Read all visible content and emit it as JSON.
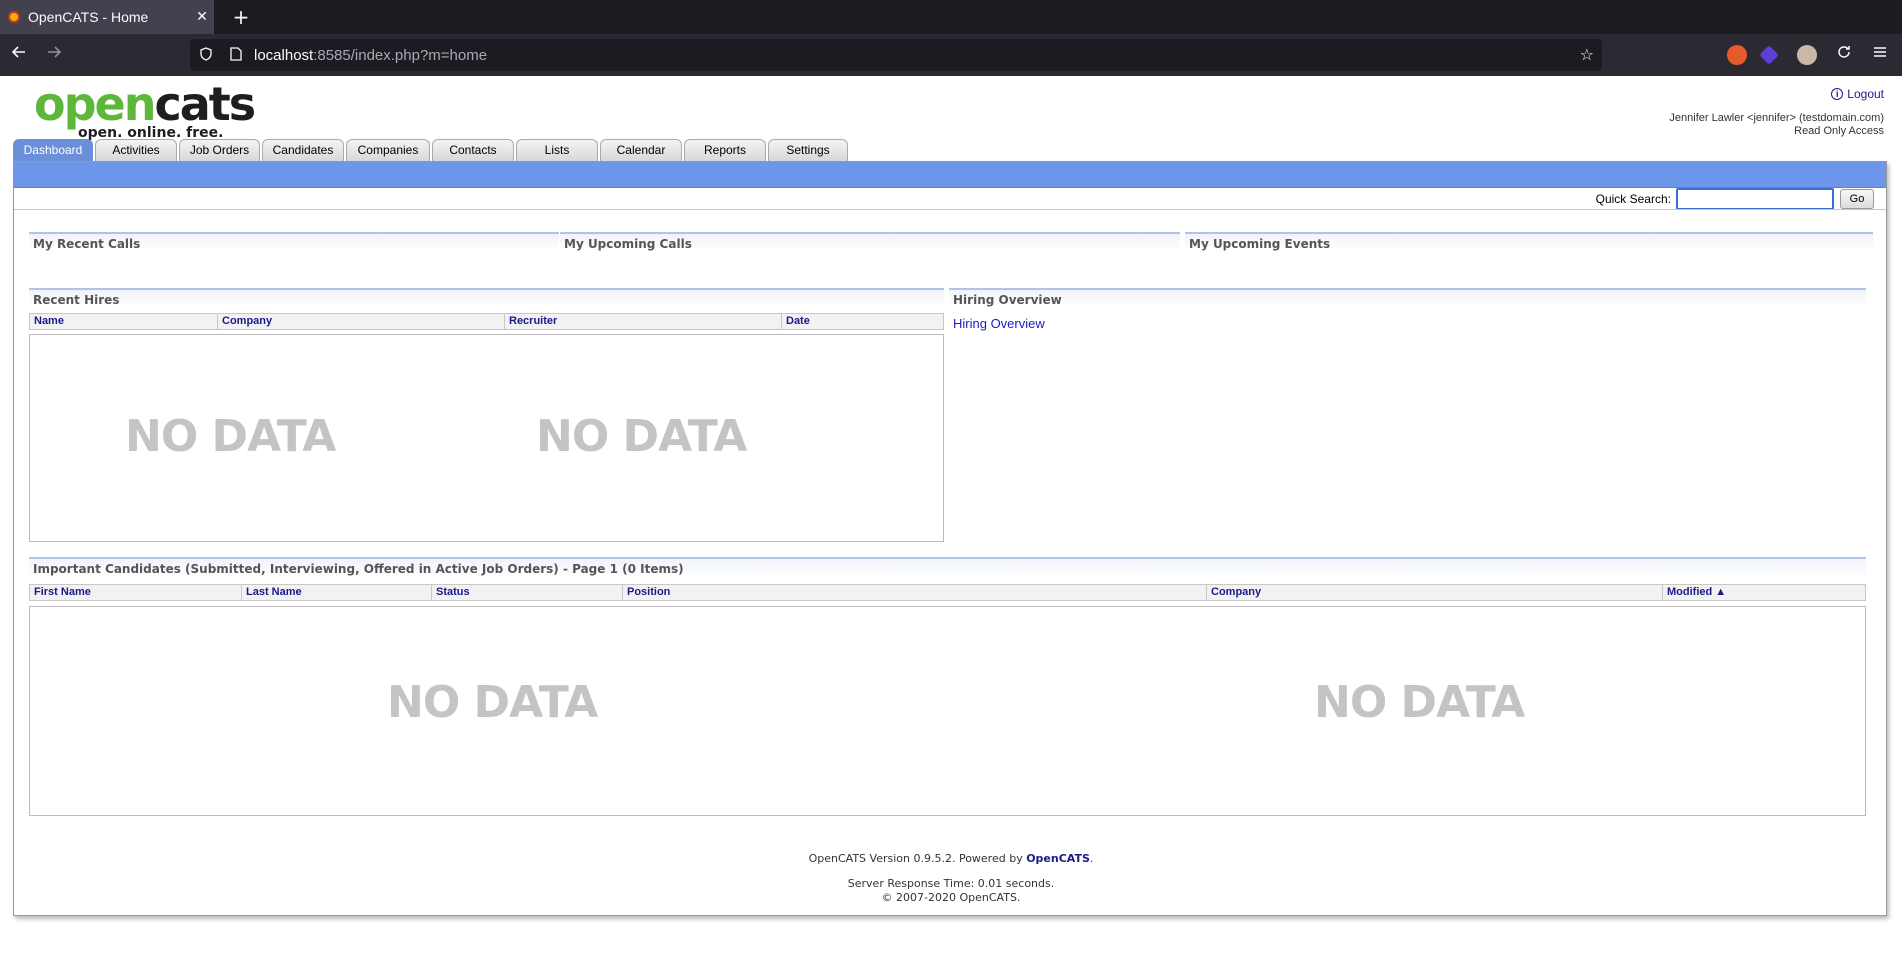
{
  "browser": {
    "tab_title": "OpenCATS - Home",
    "tab_close": "✕",
    "new_tab": "+",
    "url_host": "localhost",
    "url_rest": ":8585/index.php?m=home"
  },
  "header": {
    "logo_open": "open",
    "logo_cats": "cats",
    "logo_tagline": "open. online. free.",
    "logout_label": "Logout",
    "user_line": "Jennifer Lawler <jennifer> (testdomain.com)",
    "access_line": "Read Only Access"
  },
  "tabs": [
    {
      "label": "Dashboard",
      "active": true
    },
    {
      "label": "Activities"
    },
    {
      "label": "Job Orders"
    },
    {
      "label": "Candidates"
    },
    {
      "label": "Companies"
    },
    {
      "label": "Contacts"
    },
    {
      "label": "Lists"
    },
    {
      "label": "Calendar"
    },
    {
      "label": "Reports"
    },
    {
      "label": "Settings"
    }
  ],
  "quick_search": {
    "label": "Quick Search:",
    "value": "",
    "go_label": "Go"
  },
  "sections": {
    "recent_calls": "My Recent Calls",
    "upcoming_calls": "My Upcoming Calls",
    "upcoming_events": "My Upcoming Events",
    "recent_hires": "Recent Hires",
    "hiring_overview": "Hiring Overview",
    "hiring_overview_link": "Hiring Overview",
    "important_candidates": "Important Candidates (Submitted, Interviewing, Offered in Active Job Orders) - Page 1 (0 Items)"
  },
  "recent_hires_columns": [
    "Name",
    "Company",
    "Recruiter",
    "Date"
  ],
  "candidates_columns": [
    "First Name",
    "Last Name",
    "Status",
    "Position",
    "Company",
    "Modified"
  ],
  "no_data": "NO DATA",
  "footer": {
    "version_prefix": "OpenCATS Version 0.9.5.2. Powered by ",
    "powered_link": "OpenCATS",
    "version_suffix": ".",
    "response_time": "Server Response Time: 0.01 seconds.",
    "copyright": "© 2007-2020 OpenCATS."
  }
}
